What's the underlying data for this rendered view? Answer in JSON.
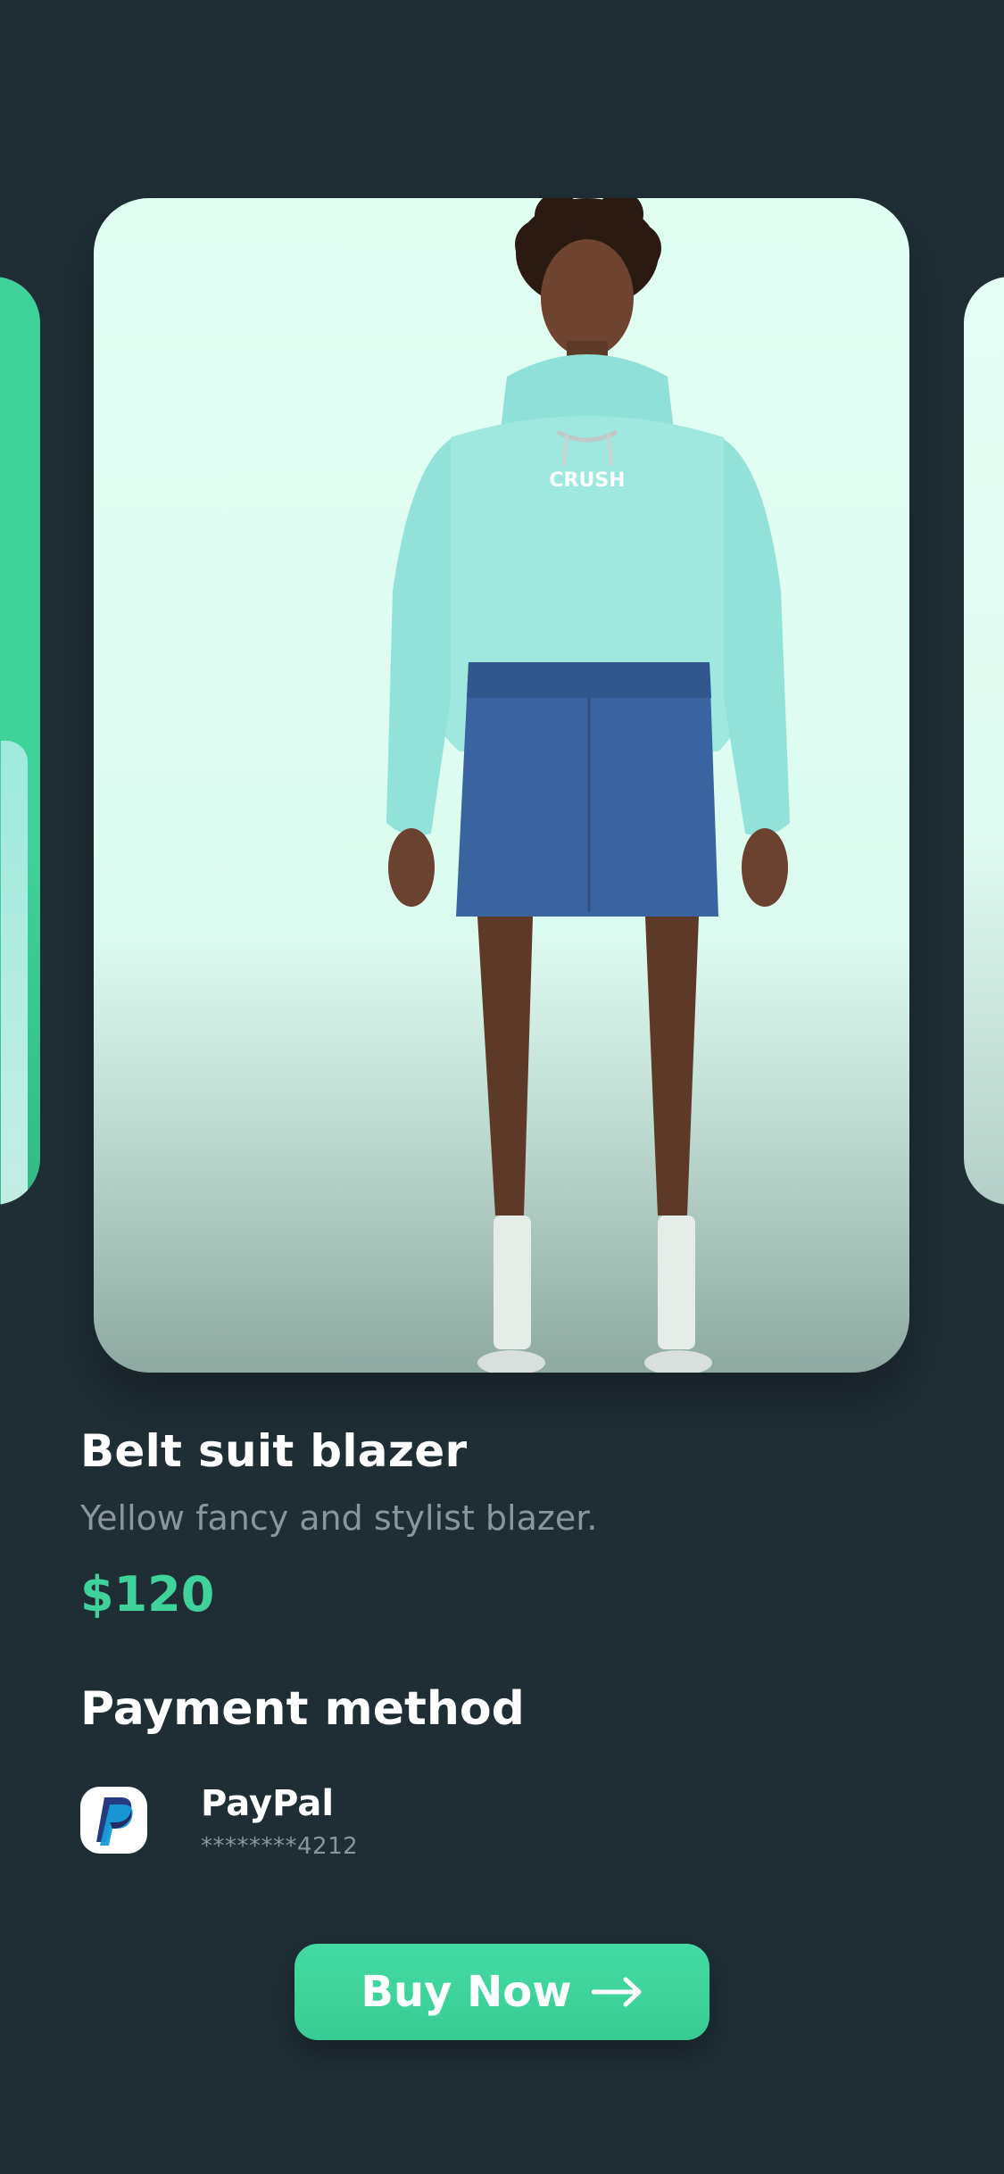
{
  "product": {
    "title": "Belt suit blazer",
    "description": "Yellow fancy and stylist blazer.",
    "price": "$120",
    "image_text": "CRUSH"
  },
  "payment": {
    "heading": "Payment method",
    "method": {
      "name": "PayPal",
      "masked_number": "********4212",
      "icon": "paypal-logo"
    }
  },
  "cta": {
    "label": "Buy Now",
    "icon": "arrow-right-icon"
  },
  "colors": {
    "background": "#1f2d35",
    "accent": "#3fd39b",
    "muted_text": "#8a969c",
    "card_background": "#e2fff4"
  }
}
